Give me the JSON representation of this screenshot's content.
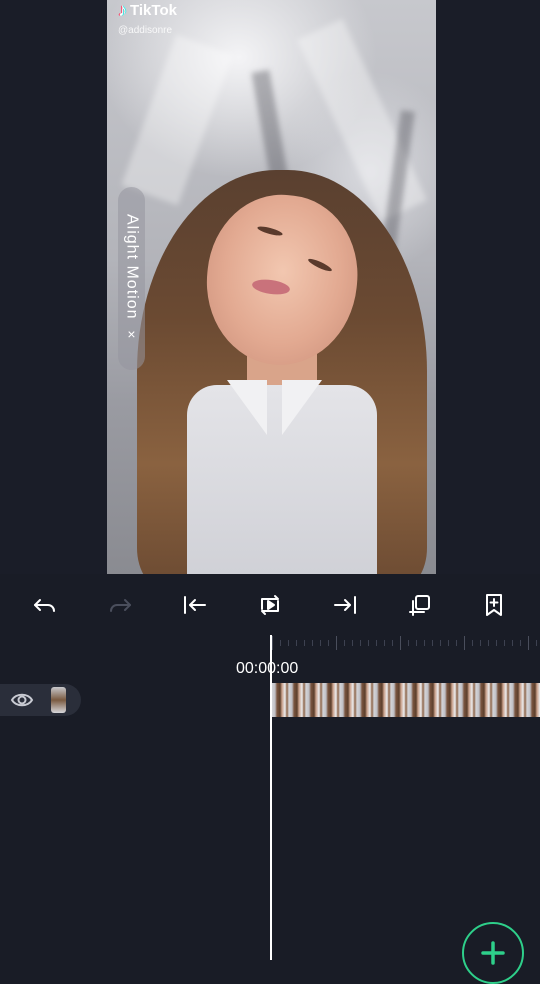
{
  "video": {
    "platform_name": "TikTok",
    "username": "@addisonre",
    "watermark_text": "Alight Motion",
    "watermark_close": "×"
  },
  "toolbar": {
    "items": [
      {
        "name": "undo",
        "icon": "undo-icon",
        "enabled": true
      },
      {
        "name": "redo",
        "icon": "redo-icon",
        "enabled": false
      },
      {
        "name": "jump-to-start",
        "icon": "jump-to-start-icon",
        "enabled": true
      },
      {
        "name": "play-loop",
        "icon": "loop-play-icon",
        "enabled": true
      },
      {
        "name": "jump-to-end",
        "icon": "jump-to-end-icon",
        "enabled": true
      },
      {
        "name": "duplicate",
        "icon": "copy-add-icon",
        "enabled": true
      },
      {
        "name": "bookmark",
        "icon": "bookmark-add-icon",
        "enabled": true
      }
    ]
  },
  "timeline": {
    "timecode": "00:00:00"
  },
  "layer": {
    "visibility_icon": "eye-icon",
    "visible": true
  },
  "fab": {
    "icon": "plus-icon",
    "accent_color": "#2ecf8a"
  },
  "colors": {
    "background": "#191c26",
    "toolbar_disabled": "#4a4e5c",
    "accent": "#2ecf8a"
  }
}
